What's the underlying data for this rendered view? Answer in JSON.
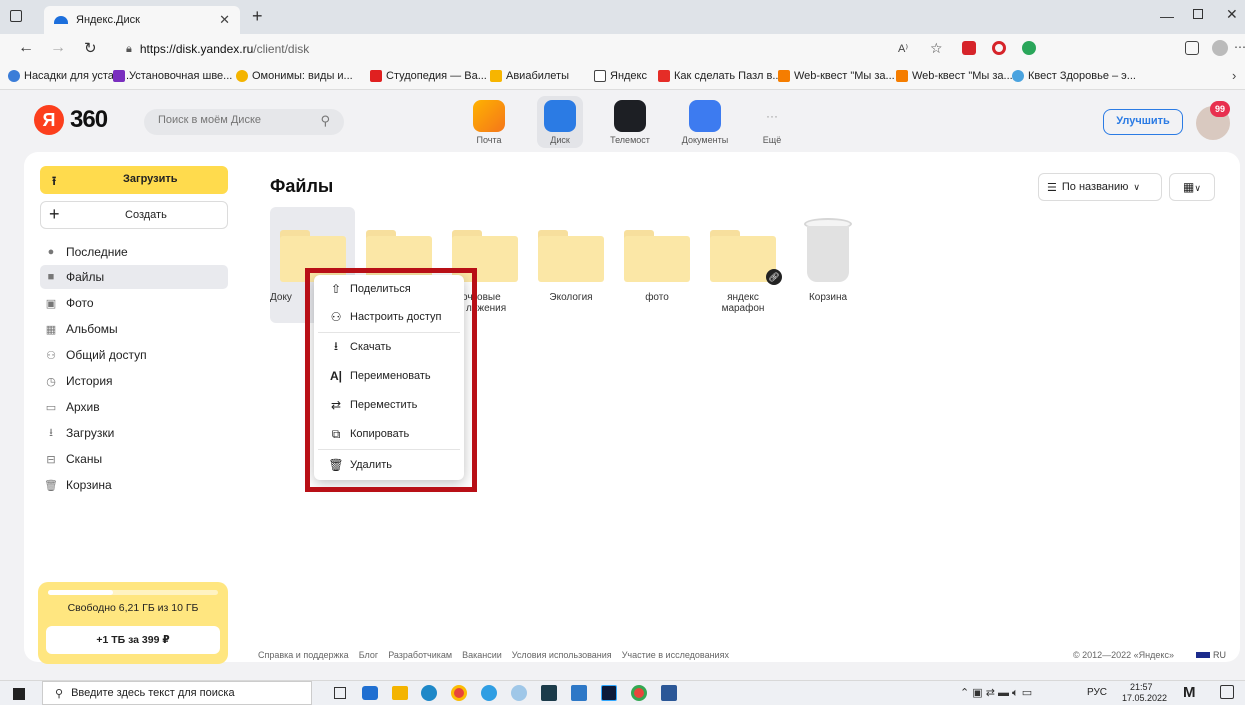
{
  "browser": {
    "tab_title": "Яндекс.Диск",
    "url_host": "https://disk.yandex.ru",
    "url_path": "/client/disk",
    "new_tab_label": "+",
    "bookmarks": [
      "Насадки для устан...",
      "Установочная шве...",
      "Омонимы: виды и...",
      "Студопедия — Ва...",
      "Авиабилеты",
      "Яндекс",
      "Как сделать Пазл в...",
      "Web-квест \"Мы за...",
      "Web-квест \"Мы за...",
      "Квест Здоровье – э..."
    ]
  },
  "header": {
    "logo_text": "360",
    "logo_letter": "Я",
    "search_placeholder": "Поиск в моём Диске",
    "services": [
      {
        "label": "Почта",
        "color": "#f5a623"
      },
      {
        "label": "Диск",
        "color": "#2b7be4"
      },
      {
        "label": "Телемост",
        "color": "#1d1f24"
      },
      {
        "label": "Документы",
        "color": "#3d7bf0"
      },
      {
        "label": "Ещё",
        "color": "#f2f2f4"
      }
    ],
    "upgrade_label": "Улучшить",
    "notifications_count": "99"
  },
  "sidebar": {
    "upload_label": "Загрузить",
    "create_label": "Создать",
    "items": [
      {
        "label": "Последние",
        "icon": "clock-icon"
      },
      {
        "label": "Файлы",
        "icon": "file-icon"
      },
      {
        "label": "Фото",
        "icon": "photo-icon"
      },
      {
        "label": "Альбомы",
        "icon": "album-icon"
      },
      {
        "label": "Общий доступ",
        "icon": "shared-icon"
      },
      {
        "label": "История",
        "icon": "history-icon"
      },
      {
        "label": "Архив",
        "icon": "archive-icon"
      },
      {
        "label": "Загрузки",
        "icon": "download-icon"
      },
      {
        "label": "Сканы",
        "icon": "scan-icon"
      },
      {
        "label": "Корзина",
        "icon": "trash-icon"
      }
    ],
    "storage_text": "Свободно 6,21 ГБ из 10 ГБ",
    "storage_used_fraction": 0.38,
    "offer_label": "+1 ТБ за 399 ₽"
  },
  "main": {
    "title": "Файлы",
    "sort_label": "По названию",
    "folders": [
      {
        "label": "Доку"
      },
      {
        "label": ""
      },
      {
        "label": "…очтовые …ложения"
      },
      {
        "label": "Экология"
      },
      {
        "label": "фото"
      },
      {
        "label": "яндекс марафон"
      }
    ],
    "trash_label": "Корзина",
    "folder_label_partial_1": "Доку",
    "folder_label_partial_2a": "очтовые",
    "folder_label_partial_2b": "ложения",
    "folder_label_3": "Экология",
    "folder_label_4": "фото",
    "folder_label_5a": "яндекс",
    "folder_label_5b": "марафон"
  },
  "context_menu": {
    "items": [
      "Поделиться",
      "Настроить доступ",
      "Скачать",
      "Переименовать",
      "Переместить",
      "Копировать",
      "Удалить"
    ]
  },
  "footer": {
    "links": [
      "Справка и поддержка",
      "Блог",
      "Разработчикам",
      "Вакансии",
      "Условия использования",
      "Участие в исследованиях"
    ],
    "copyright": "© 2012—2022 «Яндекс»",
    "lang": "RU"
  },
  "taskbar": {
    "search_placeholder": "Введите здесь текст для поиска",
    "lang": "РУС",
    "time": "21:57",
    "date": "17.05.2022"
  },
  "colors": {
    "accent_yellow": "#ffdb4d",
    "folder": "#fbe7a6",
    "highlight_frame": "#b80f16",
    "upgrade_blue": "#2b7be4"
  }
}
